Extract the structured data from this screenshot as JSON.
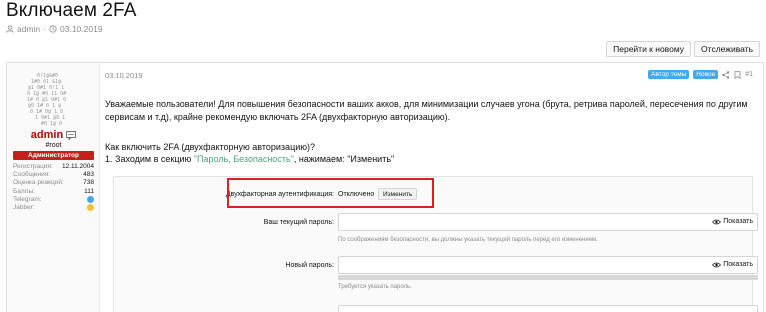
{
  "thread": {
    "title": "Включаем 2FA",
    "author": "admin",
    "date": "03.10.2019"
  },
  "actions": {
    "new_label": "Перейти к новому",
    "watch_label": "Отслеживать"
  },
  "user": {
    "name": "admin",
    "handle": "#root",
    "role": "Администратор",
    "stats": [
      {
        "key": "Регистрация:",
        "value": "12.11.2004"
      },
      {
        "key": "Сообщения:",
        "value": "483"
      },
      {
        "key": "Оценка реакций:",
        "value": "738"
      },
      {
        "key": "Баллы:",
        "value": "111"
      },
      {
        "key": "Telegram:",
        "value": ""
      },
      {
        "key": "Jabber:",
        "value": ""
      }
    ]
  },
  "post": {
    "date": "03.10.2019",
    "badge_author": "Автор темы",
    "badge_new": "Новое",
    "post_number": "#1",
    "paragraph": "Уважаемые пользователи! Для повышения безопасности ваших акков, для минимизации случаев угона (брута, ретрива паролей, пересечения по другим сервисам и т.д), крайне рекомендую включать 2FA (двухфакторную авторизацию).",
    "question": "Как включить 2FA (двухфакторную авторизацию)?",
    "step1_prefix": "1. Заходим в секцию ",
    "step1_link": "\"Пароль, Безопасность\"",
    "step1_suffix": ", нажимаем: \"Изменить\""
  },
  "panel": {
    "twofa_label": "Двухфакторная аутентификация:",
    "twofa_value": "Отключено",
    "change_label": "Изменить",
    "current_pw_label": "Ваш текущий пароль:",
    "current_pw_hint": "По соображениям безопасности, вы должны указать текущий пароль перед его изменением.",
    "new_pw_label": "Новый пароль:",
    "new_pw_hint": "Требуется указать пароль.",
    "show_label": "Показать"
  },
  "colors": {
    "accent": "#47a7eb",
    "role_badge": "#c4211c",
    "username": "#c00000",
    "highlight_box": "#e02020",
    "link_green": "#47a779"
  }
}
